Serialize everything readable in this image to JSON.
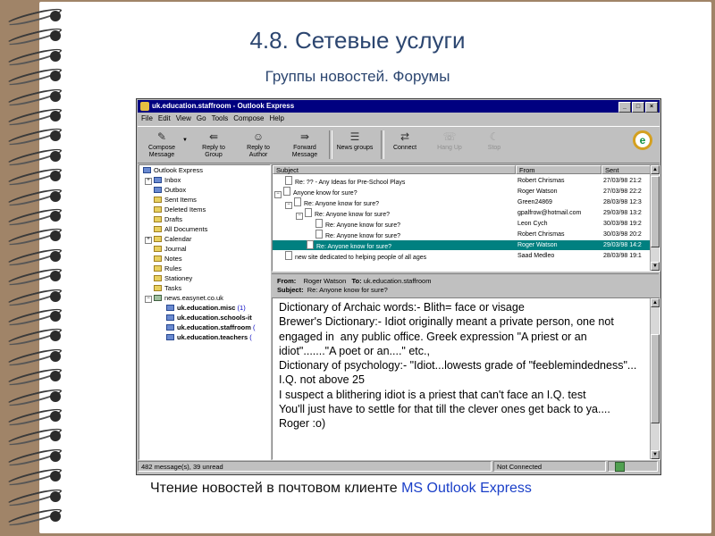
{
  "slide": {
    "heading": "4.8. Сетевые услуги",
    "subheading": "Группы новостей. Форумы",
    "caption_text": "Чтение новостей в почтовом клиенте ",
    "caption_highlight": "MS Outlook Express"
  },
  "window": {
    "title": "uk.education.staffroom - Outlook Express",
    "controls": {
      "minimize": "_",
      "maximize": "□",
      "close": "×"
    }
  },
  "menu": [
    "File",
    "Edit",
    "View",
    "Go",
    "Tools",
    "Compose",
    "Help"
  ],
  "toolbar": {
    "compose_l1": "Compose",
    "compose_l2": "Message",
    "reply_group_l1": "Reply to",
    "reply_group_l2": "Group",
    "reply_author_l1": "Reply to",
    "reply_author_l2": "Author",
    "forward_l1": "Forward",
    "forward_l2": "Message",
    "news_groups": "News groups",
    "connect": "Connect",
    "hang_up": "Hang Up",
    "stop": "Stop"
  },
  "folders": [
    {
      "label": "Outlook Express"
    },
    {
      "label": "Inbox"
    },
    {
      "label": "Outbox"
    },
    {
      "label": "Sent Items"
    },
    {
      "label": "Deleted Items"
    },
    {
      "label": "Drafts"
    },
    {
      "label": "All Documents"
    },
    {
      "label": "Calendar"
    },
    {
      "label": "Journal"
    },
    {
      "label": "Notes"
    },
    {
      "label": "Rules"
    },
    {
      "label": "Stationey"
    },
    {
      "label": "Tasks"
    },
    {
      "label": "news.easynet.co.uk"
    },
    {
      "label": "uk.education.misc",
      "count": "(1)"
    },
    {
      "label": "uk.education.schools-it",
      "count": ""
    },
    {
      "label": "uk.education.staffroom",
      "count": "("
    },
    {
      "label": "uk.education.teachers",
      "count": "("
    }
  ],
  "list": {
    "headers": {
      "subject": "Subject",
      "from": "From",
      "sent": "Sent"
    },
    "rows": [
      {
        "subject": "Re: ?? - Any Ideas for Pre-School Plays",
        "from": "Robert Chrismas",
        "sent": "27/03/98 21:2"
      },
      {
        "subject": "Anyone know for sure?",
        "from": "Roger Watson",
        "sent": "27/03/98 22:2"
      },
      {
        "subject": "Re: Anyone know for sure?",
        "from": "Green24869",
        "sent": "28/03/98 12:3"
      },
      {
        "subject": "Re: Anyone know for sure?",
        "from": "gpalfrow@hotmail.com",
        "sent": "29/03/98 13:2"
      },
      {
        "subject": "Re: Anyone know for sure?",
        "from": "Leon Cych",
        "sent": "30/03/98 19:2"
      },
      {
        "subject": "Re: Anyone know for sure?",
        "from": "Robert Chrismas",
        "sent": "30/03/98 20:2"
      },
      {
        "subject": "Re: Anyone know for sure?",
        "from": "Roger Watson",
        "sent": "29/03/98 14:2"
      },
      {
        "subject": "new site dedicated to helping people of all ages",
        "from": "Saad Medleo",
        "sent": "28/03/98 19:1"
      }
    ]
  },
  "preview": {
    "from_label": "From:",
    "from_value": "Roger Watson",
    "to_label": "To:",
    "to_value": "uk.education.staffroom",
    "subject_label": "Subject:",
    "subject_value": "Re: Anyone know for sure?",
    "body": "Dictionary of Archaic words:- Blith= face or visage\nBrewer's Dictionary:- Idiot originally meant a private person, one not\nengaged in  any public office. Greek expression \"A priest or an idiot\".......\"A poet or an....\" etc.,\nDictionary of psychology:- \"Idiot...lowests grade of \"feeblemindedness\"... I.Q. not above 25\nI suspect a blithering idiot is a priest that can't face an I.Q. test\nYou'll just have to settle for that till the clever ones get back to ya....\nRoger :o)"
  },
  "status": {
    "messages": "482 message(s), 39 unread",
    "connection": "Not Connected"
  },
  "colors": {
    "background": "#a08468",
    "title": "#2c4670",
    "selection": "#008080",
    "titlebar": "#000080"
  }
}
